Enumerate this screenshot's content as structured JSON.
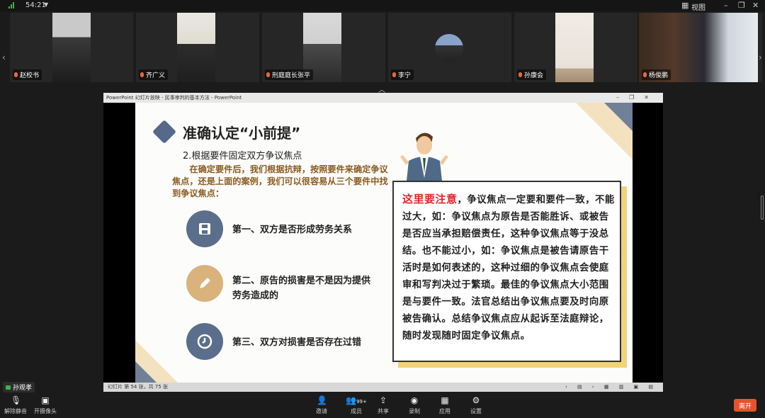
{
  "status_bar": {
    "time": "54:21",
    "view_label": "视图"
  },
  "participants": [
    {
      "name": "赵校书"
    },
    {
      "name": "齐广义"
    },
    {
      "name": "刑庭庭长张平"
    },
    {
      "name": "李宁"
    },
    {
      "name": "孙康会"
    },
    {
      "name": "杨俊鹏"
    }
  ],
  "ppt": {
    "window_title": "PowerPoint 幻灯片放映 - 民事审判的基本方法 - PowerPoint",
    "status": "幻灯片 第 54 张，共 75 张",
    "slide": {
      "title": "准确认定“小前提”",
      "subtitle": "2.根据要件固定双方争议焦点",
      "intro": "在确定要件后，我们根据抗辩，按照要件来确定争议焦点，还是上面的案例，我们可以很容易从三个要件中找到争议焦点：",
      "points": [
        {
          "text": "第一、双方是否形成劳务关系",
          "icon": "save-icon"
        },
        {
          "text": "第二、原告的损害是不是因为提供劳务造成的",
          "icon": "pencil-icon"
        },
        {
          "text": "第三、双方对损害是否存在过错",
          "icon": "clock-icon"
        }
      ],
      "note_highlight": "这里要注意",
      "note_body": "，争议焦点一定要和要件一致，不能过大，如：争议焦点为原告是否能胜诉、或被告是否应当承担赔偿责任，这种争议焦点等于没总结。也不能过小，如：争议焦点是被告请原告干活时是如何表述的，这种过细的争议焦点会使庭审和写判决过于繁琐。最佳的争议焦点大小范围是与要件一致。法官总结出争议焦点要及时向原被告确认。总结争议焦点应从起诉至法庭辩论，随时发现随时固定争议焦点。"
    }
  },
  "self_view": {
    "name": "孙观孝"
  },
  "toolbar": {
    "unmute": "解除静音",
    "camera": "开摄像头",
    "invite": "邀请",
    "members": "成员",
    "members_count": "99+",
    "share": "共享",
    "record": "录制",
    "apps": "应用",
    "settings": "设置",
    "leave": "离开"
  },
  "colors": {
    "accent_blue": "#55698a",
    "accent_gold": "#d9b27c",
    "note_red": "#e0262b",
    "leave_orange": "#e5532d"
  }
}
